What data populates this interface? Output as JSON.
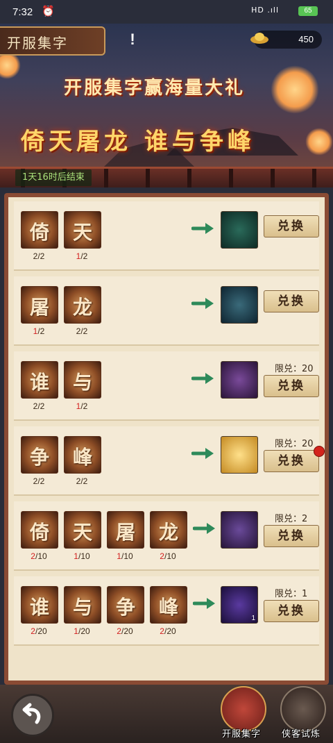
{
  "status": {
    "time": "7:32",
    "network": "HD .ıll",
    "battery": "65"
  },
  "header": {
    "title": "开服集字",
    "help": "!",
    "currency": "450"
  },
  "banner": {
    "slogan_line1": "开服集字赢海量大礼",
    "slogan_line2": "倚天屠龙 谁与争峰",
    "countdown": "1天16时后结束"
  },
  "exchange_button_label": "兑换",
  "rows": [
    {
      "chars": [
        {
          "char": "倚",
          "have": "2",
          "need": "2"
        },
        {
          "char": "天",
          "have": "1",
          "need": "2"
        }
      ],
      "reward": "copper-coin",
      "limit": ""
    },
    {
      "chars": [
        {
          "char": "屠",
          "have": "1",
          "need": "2"
        },
        {
          "char": "龙",
          "have": "2",
          "need": "2"
        }
      ],
      "reward": "skill-book",
      "limit": ""
    },
    {
      "chars": [
        {
          "char": "谁",
          "have": "2",
          "need": "2"
        },
        {
          "char": "与",
          "have": "1",
          "need": "2"
        }
      ],
      "reward": "purple-orb",
      "limit": "限兑：20"
    },
    {
      "chars": [
        {
          "char": "争",
          "have": "2",
          "need": "2"
        },
        {
          "char": "峰",
          "have": "2",
          "need": "2"
        }
      ],
      "reward": "golden-scroll",
      "limit": "限兑：20"
    },
    {
      "chars": [
        {
          "char": "倚",
          "have": "2",
          "need": "10"
        },
        {
          "char": "天",
          "have": "1",
          "need": "10"
        },
        {
          "char": "屠",
          "have": "1",
          "need": "10"
        },
        {
          "char": "龙",
          "have": "2",
          "need": "10"
        }
      ],
      "reward": "gold-ingot",
      "limit": "限兑：2"
    },
    {
      "chars": [
        {
          "char": "谁",
          "have": "2",
          "need": "20"
        },
        {
          "char": "与",
          "have": "1",
          "need": "20"
        },
        {
          "char": "争",
          "have": "2",
          "need": "20"
        },
        {
          "char": "峰",
          "have": "2",
          "need": "20"
        }
      ],
      "reward": "purple-token",
      "limit": "限兑：1",
      "reward_qty": "1"
    }
  ],
  "bottom": {
    "back": "back",
    "tab1": "开服集字",
    "tab2": "侠客试炼"
  }
}
